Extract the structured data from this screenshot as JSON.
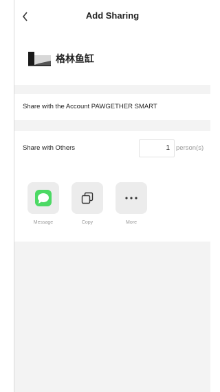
{
  "header": {
    "title": "Add Sharing"
  },
  "device": {
    "name": "格林鱼缸"
  },
  "share_account": {
    "label": "Share with the Account PAWGETHER SMART"
  },
  "share_others": {
    "label": "Share with Others",
    "count": "1",
    "unit": "person(s)"
  },
  "share_options": [
    {
      "label": "Message",
      "icon": "message-icon",
      "color": "#4cd964"
    },
    {
      "label": "Copy",
      "icon": "copy-icon"
    },
    {
      "label": "More",
      "icon": "more-icon"
    }
  ]
}
